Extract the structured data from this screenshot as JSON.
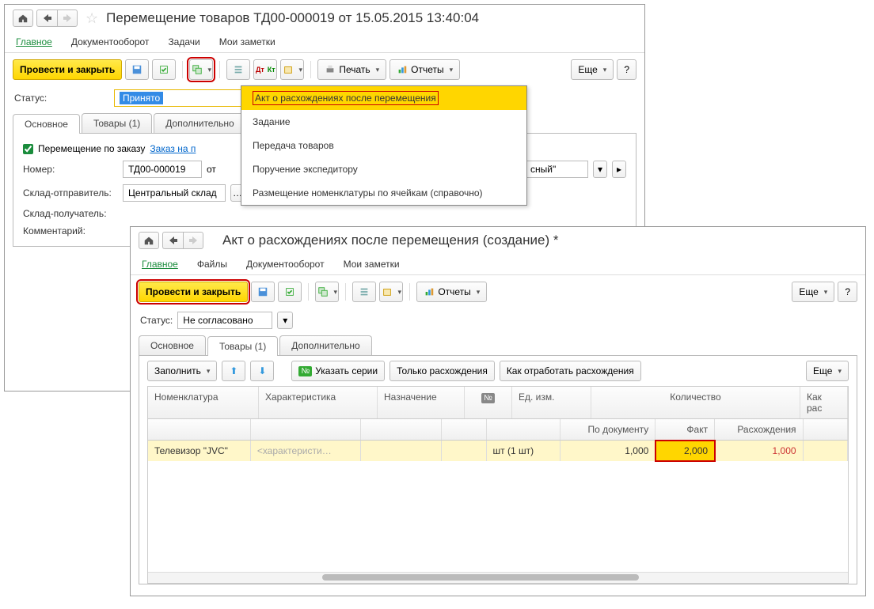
{
  "window1": {
    "title": "Перемещение товаров ТД00-000019 от 15.05.2015 13:40:04",
    "menu": {
      "main": "Главное",
      "docflow": "Документооборот",
      "tasks": "Задачи",
      "notes": "Мои заметки"
    },
    "toolbar": {
      "post_close": "Провести и закрыть",
      "print": "Печать",
      "reports": "Отчеты",
      "more": "Еще",
      "help": "?"
    },
    "dropdown": {
      "item1": "Акт о расхождениях после перемещения",
      "item2": "Задание",
      "item3": "Передача товаров",
      "item4": "Поручение экспедитору",
      "item5": "Размещение номенклатуры по ячейкам (справочно)"
    },
    "status_label": "Статус:",
    "status_value": "Принято",
    "tabs": {
      "main": "Основное",
      "goods": "Товары (1)",
      "extra": "Дополнительно"
    },
    "move_by_order": "Перемещение по заказу",
    "order_link": "Заказ на п",
    "number_label": "Номер:",
    "number_value": "ТД00-000019",
    "date_from": "от",
    "priority_trail": "сный\"",
    "sender_label": "Склад-отправитель:",
    "sender_value": "Центральный склад",
    "receiver_label": "Склад-получатель:",
    "comment_label": "Комментарий:"
  },
  "window2": {
    "title": "Акт о расхождениях после перемещения (создание) *",
    "menu": {
      "main": "Главное",
      "files": "Файлы",
      "docflow": "Документооборот",
      "notes": "Мои заметки"
    },
    "toolbar": {
      "post_close": "Провести и закрыть",
      "reports": "Отчеты",
      "more": "Еще",
      "help": "?"
    },
    "status_label": "Статус:",
    "status_value": "Не согласовано",
    "tabs": {
      "main": "Основное",
      "goods": "Товары (1)",
      "extra": "Дополнительно"
    },
    "grid_toolbar": {
      "fill": "Заполнить",
      "series": "Указать серии",
      "only_diff": "Только расхождения",
      "how": "Как отработать расхождения",
      "more": "Еще"
    },
    "columns": {
      "nom": "Номенклатура",
      "char": "Характеристика",
      "naz": "Назначение",
      "ed": "Ед. изм.",
      "qty": "Количество",
      "doc": "По документу",
      "fact": "Факт",
      "diff": "Расхождения",
      "how": "Как",
      "how2": "рас"
    },
    "row1": {
      "nom": "Телевизор \"JVC\"",
      "char": "<характеристи…",
      "ed": "шт (1 шт)",
      "doc": "1,000",
      "fact": "2,000",
      "diff": "1,000"
    }
  }
}
